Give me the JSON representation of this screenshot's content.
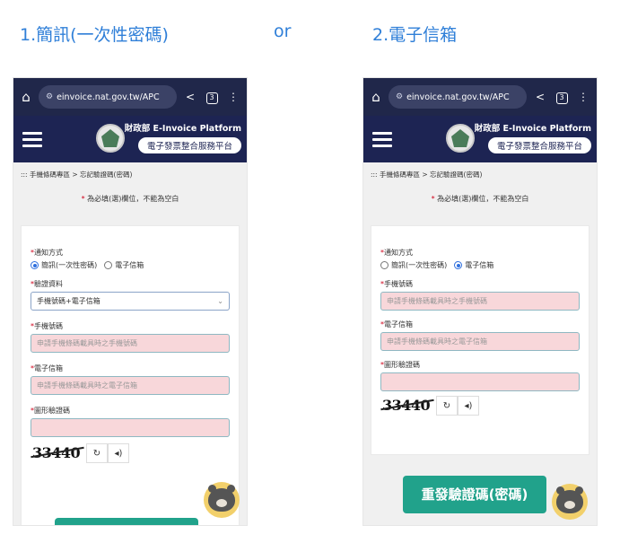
{
  "headings": {
    "option1": "1.簡訊(一次性密碼)",
    "separator": "or",
    "option2": "2.電子信箱"
  },
  "browser": {
    "url": "einvoice.nat.gov.tw/APC",
    "tabs_count": "3"
  },
  "site": {
    "title_line1": "財政部 E-Invoice Platform",
    "title_line2": "電子發票整合服務平台"
  },
  "page": {
    "breadcrumb": "::: 手機條碼專區 > 忘記驗證碼(密碼)",
    "required_note": "為必填(選)欄位，不能為空白"
  },
  "form": {
    "notify_label": "通知方式",
    "notify_options": [
      "簡訊(一次性密碼)",
      "電子信箱"
    ],
    "verify_label": "驗證資料",
    "verify_value": "手機號碼+電子信箱",
    "phone_label": "手機號碼",
    "phone_placeholder": "申請手機條碼載具時之手機號碼",
    "email_label": "電子信箱",
    "email_placeholder": "申請手機條碼載具時之電子信箱",
    "captcha_label": "圖形驗證碼",
    "captcha_text": "33440"
  },
  "screenA": {
    "selected_option_index": 0
  },
  "screenB": {
    "selected_option_index": 1,
    "submit_label": "重發驗證碼(密碼)"
  },
  "colors": {
    "heading": "#2f7fd8",
    "navy": "#1d2453",
    "green": "#21a28b",
    "pink_field": "#f8d7da"
  }
}
